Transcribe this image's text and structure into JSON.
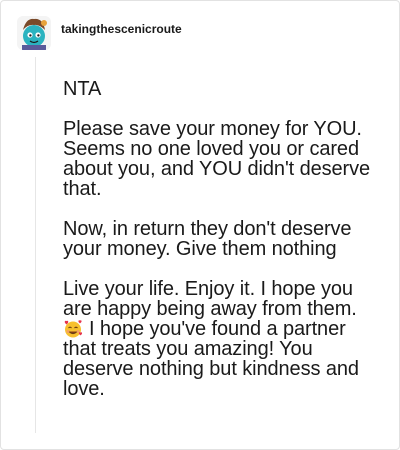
{
  "post": {
    "username": "takingthescenicroute",
    "avatar_icon": "avatar-cartoon-character-icon",
    "paragraphs": [
      "NTA",
      "Please save your money for YOU. Seems no one loved you or cared about you, and YOU didn't deserve that.",
      "Now, in return they don't deserve your money. Give them nothing",
      "Live your life. Enjoy it. I hope you are happy being away from them."
    ],
    "last_paragraph_after_emoji": "I hope you've found a partner that treats you amazing! You deserve nothing but kindness and love.",
    "emoji_icon": "smiling-face-with-hearts-icon"
  },
  "colors": {
    "text": "#1a1a1a",
    "border": "#e2e2e2",
    "thread_line": "#e6e6e6",
    "background": "#ffffff"
  }
}
